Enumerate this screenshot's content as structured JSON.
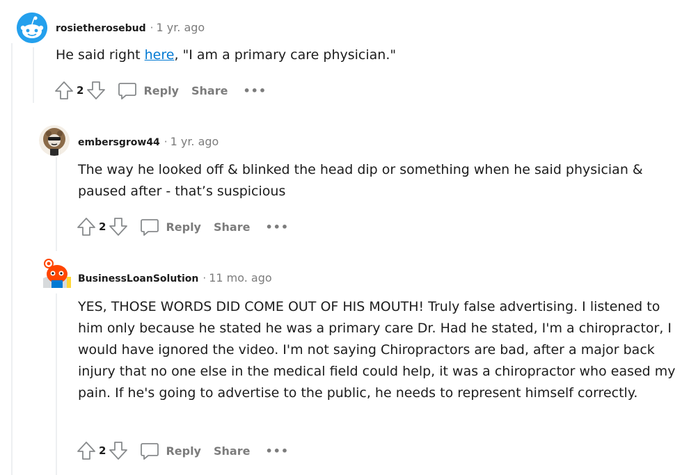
{
  "comments": [
    {
      "author": "rosietherosebud",
      "time": "1 yr. ago",
      "body_pre": "He said right ",
      "body_link": "here",
      "body_post": ", \"I am a primary care physician.\"",
      "votes": "2",
      "reply_label": "Reply",
      "share_label": "Share",
      "more_label": "•••"
    },
    {
      "author": "embersgrow44",
      "time": "1 yr. ago",
      "body": "The way he looked off & blinked the head dip or something when he said physician & paused after - that’s suspicious",
      "votes": "2",
      "reply_label": "Reply",
      "share_label": "Share",
      "more_label": "•••"
    },
    {
      "author": "BusinessLoanSolution",
      "time": "11 mo. ago",
      "body": "YES, THOSE WORDS DID COME OUT OF HIS MOUTH! Truly false advertising. I listened to him only because he stated he was a primary care Dr. Had he stated, I'm a chiropractor, I would have ignored the video. I'm not saying Chiropractors are bad, after a major back injury that no one else in the medical field could help, it was a chiropractor who eased my pain. If he's going to advertise to the public, he needs to represent himself correctly.",
      "votes": "2",
      "reply_label": "Reply",
      "share_label": "Share",
      "more_label": "•••"
    }
  ],
  "separator": "·",
  "colors": {
    "link": "#0079d3",
    "muted": "#7c7c7c",
    "thread_line": "#edeff1",
    "avatar1_bg": "#24a0ed",
    "avatar3_bg": "#ff4500"
  },
  "icons": [
    "upvote-icon",
    "downvote-icon",
    "comment-bubble-icon",
    "more-dots-icon"
  ]
}
